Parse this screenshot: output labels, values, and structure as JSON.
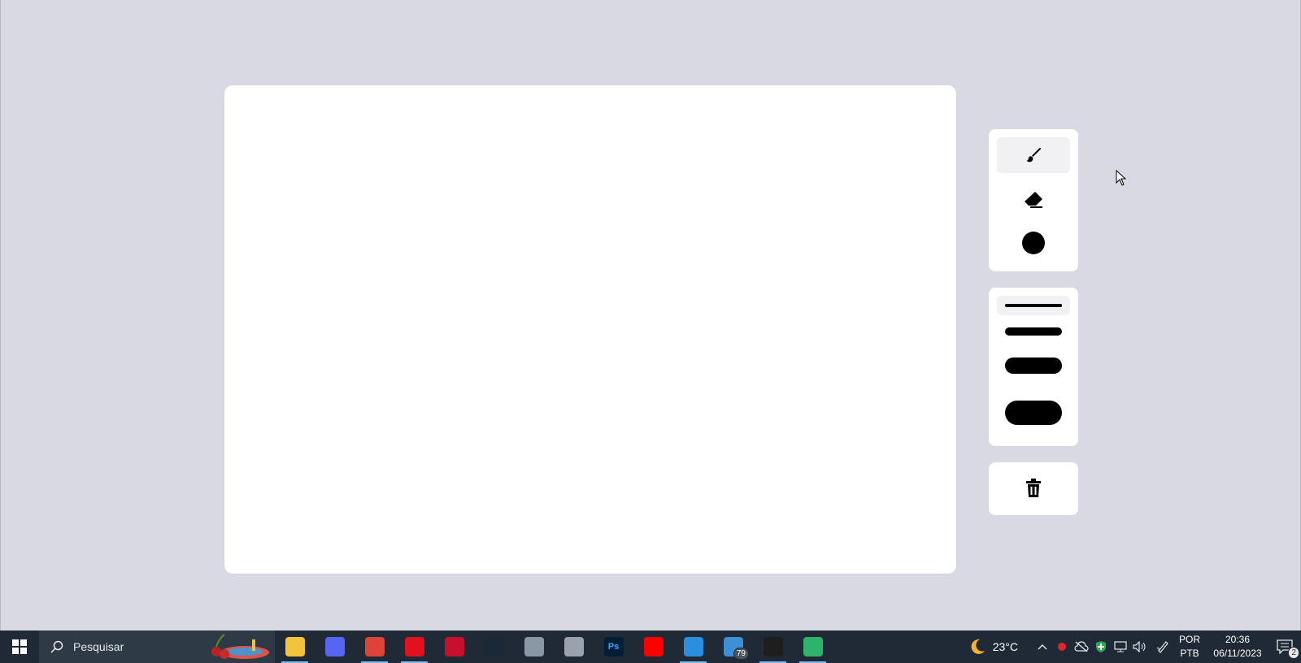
{
  "app": {
    "tools": [
      {
        "name": "brush",
        "icon": "paintbrush-icon",
        "active": true
      },
      {
        "name": "eraser",
        "icon": "eraser-icon",
        "active": false
      },
      {
        "name": "color",
        "icon": "color-swatch-icon",
        "color": "#000000",
        "active": false
      }
    ],
    "sizes": [
      {
        "name": "size-1",
        "active": true
      },
      {
        "name": "size-2",
        "active": false
      },
      {
        "name": "size-3",
        "active": false
      },
      {
        "name": "size-4",
        "active": false
      }
    ],
    "actions": [
      {
        "name": "clear",
        "icon": "trash-icon"
      }
    ]
  },
  "taskbar": {
    "search_placeholder": "Pesquisar",
    "apps": [
      {
        "name": "file-explorer",
        "icon": "folder-icon",
        "color": "#f3c33c",
        "running": true
      },
      {
        "name": "discord",
        "icon": "discord-icon",
        "color": "#5865f2",
        "running": false
      },
      {
        "name": "chrome",
        "icon": "chrome-icon",
        "color": "#db4437",
        "running": true
      },
      {
        "name": "opera",
        "icon": "opera-icon",
        "color": "#e3111e",
        "running": true
      },
      {
        "name": "app-red",
        "icon": "bolt-icon",
        "color": "#c8102e",
        "running": false
      },
      {
        "name": "steam",
        "icon": "steam-icon",
        "color": "#1b2838",
        "running": false
      },
      {
        "name": "app-gray",
        "icon": "photos-icon",
        "color": "#8a97a5",
        "running": false
      },
      {
        "name": "app-disc",
        "icon": "disc-icon",
        "color": "#9aa3ad",
        "running": false
      },
      {
        "name": "photoshop",
        "icon": "photoshop-icon",
        "label": "Ps",
        "color": "#001e36",
        "running": false
      },
      {
        "name": "youtube-music",
        "icon": "youtube-music-icon",
        "color": "#ff0000",
        "running": false
      },
      {
        "name": "vscode",
        "icon": "vscode-icon",
        "color": "#2a8fe0",
        "running": true
      },
      {
        "name": "mail",
        "icon": "mail-icon",
        "color": "#3d8fd6",
        "running": false,
        "badge": "79"
      },
      {
        "name": "figma",
        "icon": "figma-icon",
        "color": "#1e1e1e",
        "running": true
      },
      {
        "name": "edge-canary",
        "icon": "browser-icon",
        "color": "#2fb36c",
        "running": true
      }
    ],
    "weather": {
      "temp": "23°C",
      "icon": "moon-icon"
    },
    "lang": {
      "line1": "POR",
      "line2": "PTB"
    },
    "clock": {
      "time": "20:36",
      "date": "06/11/2023"
    },
    "notifications": {
      "count": "2"
    }
  }
}
